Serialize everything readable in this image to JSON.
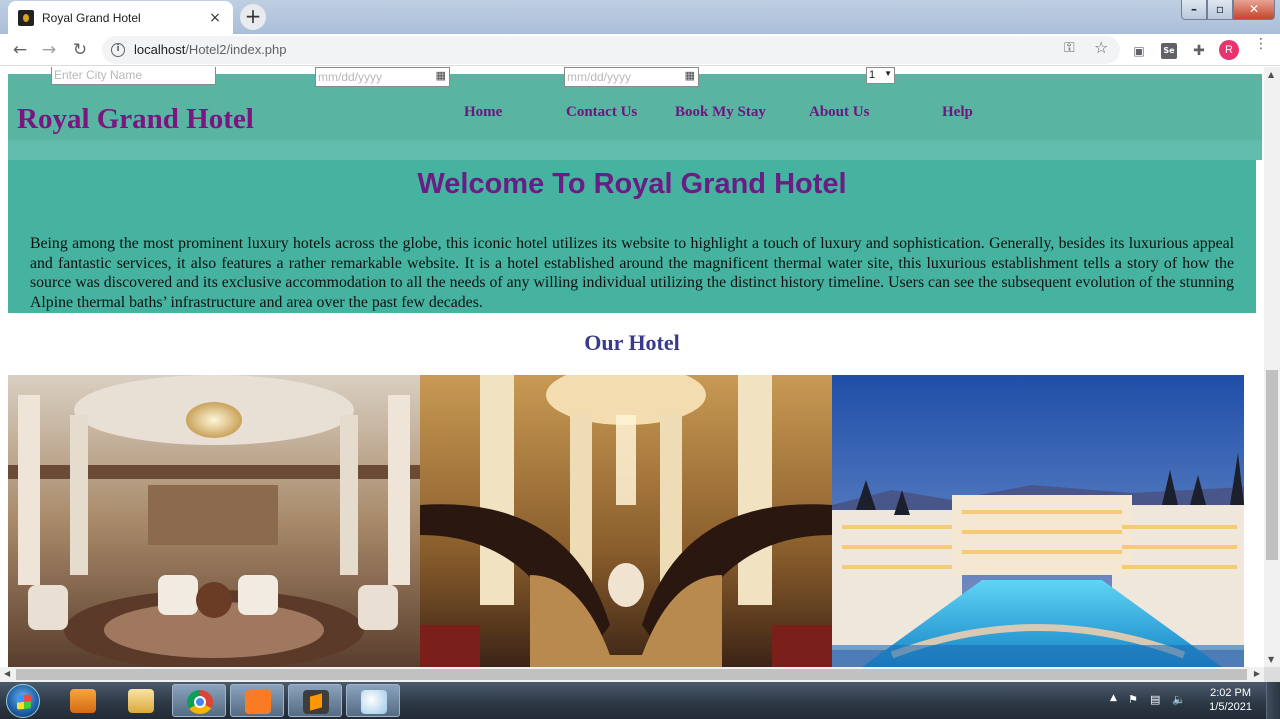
{
  "browser": {
    "tab_title": "Royal Grand Hotel",
    "tab_close": "×",
    "new_tab": "+",
    "url_host": "localhost",
    "url_path": "/Hotel2/index.php",
    "back": "←",
    "forward": "→",
    "reload": "↻",
    "profile_initial": "R",
    "icons": [
      "back-icon",
      "forward-icon",
      "reload-icon",
      "info-icon",
      "key-icon",
      "star-icon",
      "camera-icon",
      "selenium-extension-icon",
      "puzzle-icon",
      "profile-avatar",
      "menu-icon"
    ]
  },
  "search_form": {
    "city_placeholder": "Enter City Name",
    "checkin_placeholder": "mm/dd/yyyy",
    "checkout_placeholder": "mm/dd/yyyy",
    "guests_value": "1"
  },
  "header": {
    "brand": "Royal Grand Hotel",
    "nav": [
      "Home",
      "Contact Us",
      "Book My Stay",
      "About Us",
      "Help"
    ]
  },
  "welcome": {
    "heading": "Welcome To Royal Grand Hotel",
    "body": "Being among the most prominent luxury hotels across the globe, this iconic hotel utilizes its website to highlight a touch of luxury and sophistication. Generally, besides its luxurious appeal and fantastic services, it also features a rather remarkable website. It is a hotel established around the magnificent thermal water site, this luxurious establishment tells a story of how the source was discovered and its exclusive accommodation to all the needs of any willing individual utilizing the distinct history timeline. Users can see the subsequent evolution of the stunning Alpine thermal baths’ infrastructure and area over the past few decades."
  },
  "gallery": {
    "heading": "Our Hotel",
    "photos": [
      "hotel-lobby-photo",
      "grand-staircase-photo",
      "hotel-exterior-night-photo"
    ]
  },
  "taskbar": {
    "time": "2:02 PM",
    "date": "1/5/2021",
    "apps": [
      "windows-media-player",
      "file-explorer",
      "chrome",
      "xampp",
      "sublime-text",
      "paint"
    ]
  }
}
